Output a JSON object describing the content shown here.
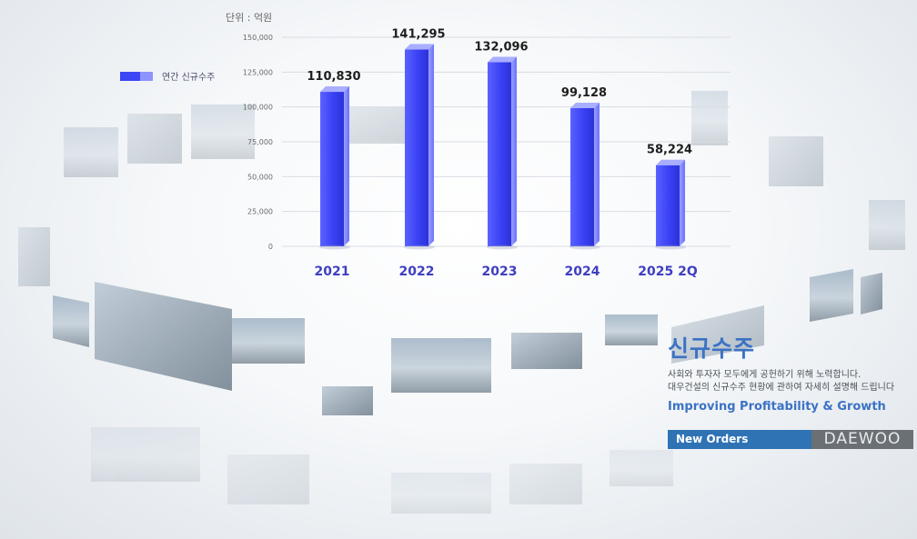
{
  "chart_data": {
    "type": "bar",
    "unit_label": "단위 : 억원",
    "legend": "연간 신규수주",
    "categories": [
      "2021",
      "2022",
      "2023",
      "2024",
      "2025 2Q"
    ],
    "series": [
      {
        "name": "연간 신규수주",
        "values": [
          110830,
          141295,
          132096,
          99128,
          58224
        ]
      }
    ],
    "data_labels": [
      "110,830",
      "141,295",
      "132,096",
      "99,128",
      "58,224"
    ],
    "yticks": [
      "0",
      "25,000",
      "50,000",
      "75,000",
      "100,000",
      "125,000",
      "150,000"
    ],
    "ytick_values": [
      0,
      25000,
      50000,
      75000,
      100000,
      125000,
      150000
    ],
    "ylim": [
      0,
      150000
    ],
    "grid": true,
    "legend_position": "top-left",
    "bar_color": "#3d46f5",
    "bar_light_color": "#8d93ff"
  },
  "info": {
    "title": "신규수주",
    "desc_line1": "사회와 투자자 모두에게 공헌하기 위해 노력합니다.",
    "desc_line2": "대우건설의 신규수주 현황에 관하여 자세히 설명해 드립니다",
    "subtitle": "Improving Profitability & Growth",
    "bar_label": "New Orders",
    "brand": "DAEWOO",
    "accent_color": "#3b72c4",
    "bar_color": "#2f73b5"
  }
}
